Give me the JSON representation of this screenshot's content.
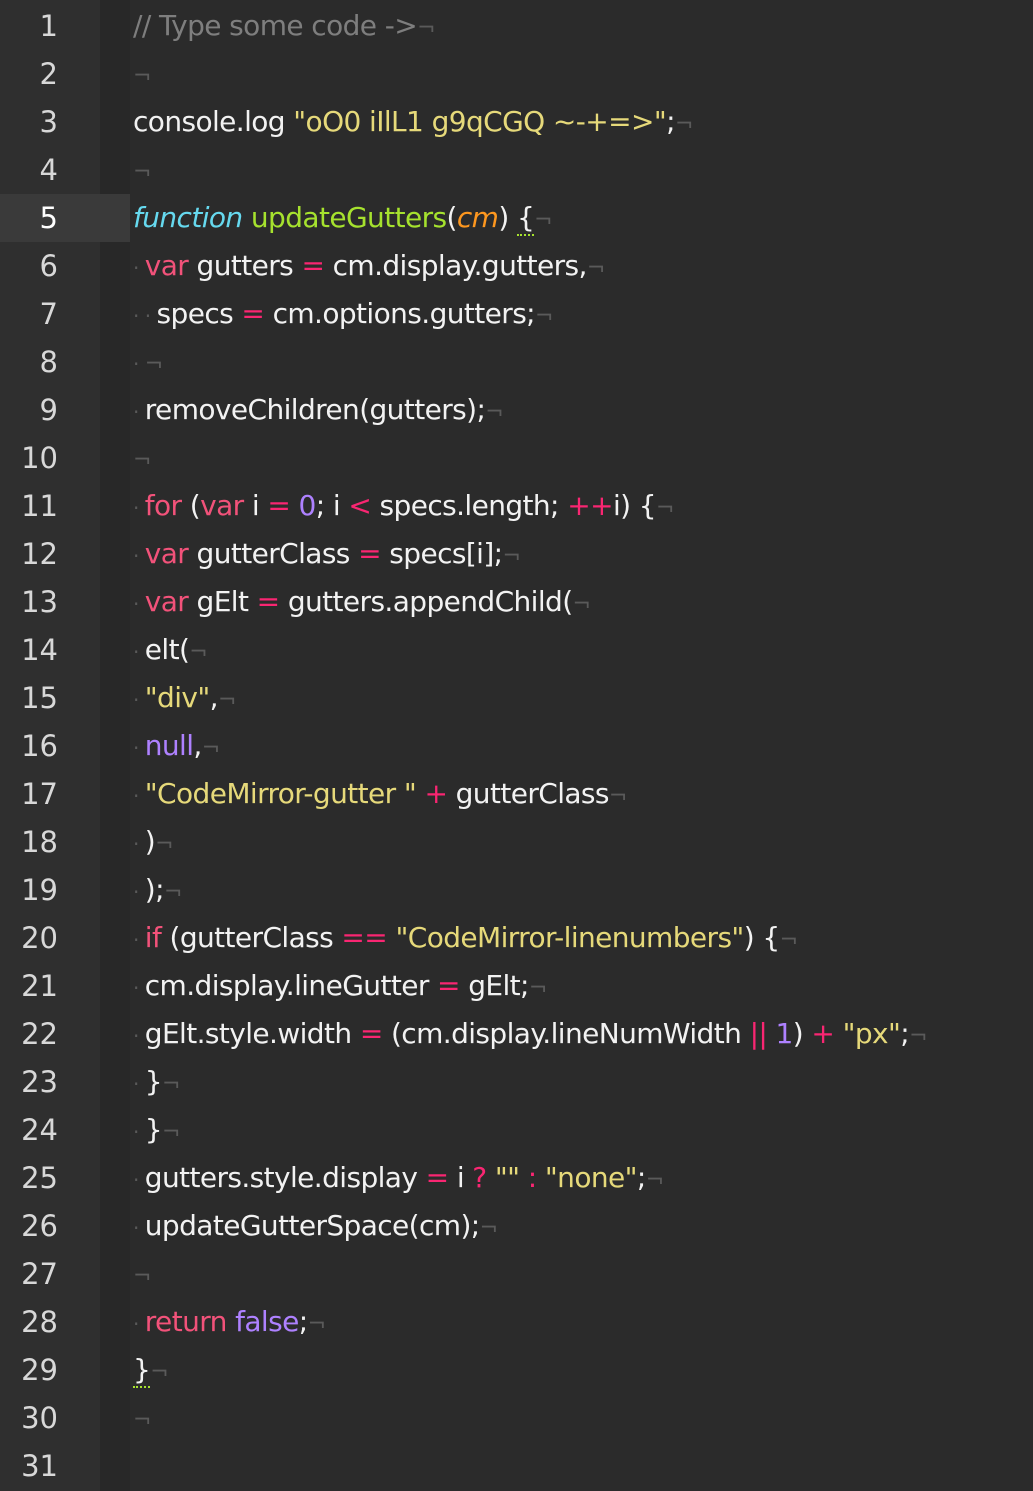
{
  "editor": {
    "active_line": 5,
    "lines": [
      {
        "n": "1",
        "indent": 0,
        "tokens": [
          {
            "c": "comment",
            "t": "// Type some code ->"
          }
        ]
      },
      {
        "n": "2",
        "indent": 0,
        "tokens": []
      },
      {
        "n": "3",
        "indent": 0,
        "tokens": [
          {
            "c": "plain",
            "t": "console.log "
          },
          {
            "c": "string",
            "t": "\"oO0 iIlL1 g9qCGQ ~-+=>\""
          },
          {
            "c": "punct",
            "t": ";"
          }
        ]
      },
      {
        "n": "4",
        "indent": 0,
        "tokens": []
      },
      {
        "n": "5",
        "indent": 0,
        "tokens": [
          {
            "c": "italic-kw",
            "t": "function"
          },
          {
            "c": "plain",
            "t": " "
          },
          {
            "c": "fn",
            "t": "updateGutters"
          },
          {
            "c": "punct",
            "t": "("
          },
          {
            "c": "param",
            "t": "cm"
          },
          {
            "c": "punct",
            "t": ") "
          },
          {
            "c": "brace",
            "t": "{"
          }
        ]
      },
      {
        "n": "6",
        "indent": 1,
        "tokens": [
          {
            "c": "keyword",
            "t": "var"
          },
          {
            "c": "plain",
            "t": " gutters "
          },
          {
            "c": "op",
            "t": "="
          },
          {
            "c": "plain",
            "t": " cm.display.gutters,"
          }
        ]
      },
      {
        "n": "7",
        "indent": 2,
        "tokens": [
          {
            "c": "plain",
            "t": "specs "
          },
          {
            "c": "op",
            "t": "="
          },
          {
            "c": "plain",
            "t": " cm.options.gutters;"
          }
        ]
      },
      {
        "n": "8",
        "indent": 1,
        "tokens": []
      },
      {
        "n": "9",
        "indent": 1,
        "tokens": [
          {
            "c": "plain",
            "t": "removeChildren(gutters);"
          }
        ]
      },
      {
        "n": "10",
        "indent": 0,
        "tokens": []
      },
      {
        "n": "11",
        "indent": 1,
        "tokens": [
          {
            "c": "keyword",
            "t": "for"
          },
          {
            "c": "plain",
            "t": " ("
          },
          {
            "c": "keyword",
            "t": "var"
          },
          {
            "c": "plain",
            "t": " i "
          },
          {
            "c": "op",
            "t": "="
          },
          {
            "c": "plain",
            "t": " "
          },
          {
            "c": "number",
            "t": "0"
          },
          {
            "c": "plain",
            "t": "; i "
          },
          {
            "c": "op",
            "t": "<"
          },
          {
            "c": "plain",
            "t": " specs.length; "
          },
          {
            "c": "op",
            "t": "++"
          },
          {
            "c": "plain",
            "t": "i) {"
          }
        ]
      },
      {
        "n": "12",
        "indent": 1,
        "tokens": [
          {
            "c": "keyword",
            "t": "var"
          },
          {
            "c": "plain",
            "t": " gutterClass "
          },
          {
            "c": "op",
            "t": "="
          },
          {
            "c": "plain",
            "t": " specs[i];"
          }
        ]
      },
      {
        "n": "13",
        "indent": 1,
        "tokens": [
          {
            "c": "keyword",
            "t": "var"
          },
          {
            "c": "plain",
            "t": " gElt "
          },
          {
            "c": "op",
            "t": "="
          },
          {
            "c": "plain",
            "t": " gutters.appendChild("
          }
        ]
      },
      {
        "n": "14",
        "indent": 1,
        "tokens": [
          {
            "c": "plain",
            "t": "elt("
          }
        ]
      },
      {
        "n": "15",
        "indent": 1,
        "tokens": [
          {
            "c": "string",
            "t": "\"div\""
          },
          {
            "c": "plain",
            "t": ","
          }
        ]
      },
      {
        "n": "16",
        "indent": 1,
        "tokens": [
          {
            "c": "constant",
            "t": "null"
          },
          {
            "c": "plain",
            "t": ","
          }
        ]
      },
      {
        "n": "17",
        "indent": 1,
        "tokens": [
          {
            "c": "string",
            "t": "\"CodeMirror-gutter \""
          },
          {
            "c": "plain",
            "t": " "
          },
          {
            "c": "op",
            "t": "+"
          },
          {
            "c": "plain",
            "t": " gutterClass"
          }
        ]
      },
      {
        "n": "18",
        "indent": 1,
        "tokens": [
          {
            "c": "plain",
            "t": ")"
          }
        ]
      },
      {
        "n": "19",
        "indent": 1,
        "tokens": [
          {
            "c": "plain",
            "t": ");"
          }
        ]
      },
      {
        "n": "20",
        "indent": 1,
        "tokens": [
          {
            "c": "keyword",
            "t": "if"
          },
          {
            "c": "plain",
            "t": " (gutterClass "
          },
          {
            "c": "op",
            "t": "=="
          },
          {
            "c": "plain",
            "t": " "
          },
          {
            "c": "string",
            "t": "\"CodeMirror-linenumbers\""
          },
          {
            "c": "plain",
            "t": ") {"
          }
        ]
      },
      {
        "n": "21",
        "indent": 1,
        "tokens": [
          {
            "c": "plain",
            "t": "cm.display.lineGutter "
          },
          {
            "c": "op",
            "t": "="
          },
          {
            "c": "plain",
            "t": " gElt;"
          }
        ]
      },
      {
        "n": "22",
        "indent": 1,
        "tokens": [
          {
            "c": "plain",
            "t": "gElt.style.width "
          },
          {
            "c": "op",
            "t": "="
          },
          {
            "c": "plain",
            "t": " (cm.display.lineNumWidth "
          },
          {
            "c": "op",
            "t": "||"
          },
          {
            "c": "plain",
            "t": " "
          },
          {
            "c": "number",
            "t": "1"
          },
          {
            "c": "plain",
            "t": ") "
          },
          {
            "c": "op",
            "t": "+"
          },
          {
            "c": "plain",
            "t": " "
          },
          {
            "c": "string",
            "t": "\"px\""
          },
          {
            "c": "plain",
            "t": ";"
          }
        ]
      },
      {
        "n": "23",
        "indent": 1,
        "tokens": [
          {
            "c": "plain",
            "t": "}"
          }
        ]
      },
      {
        "n": "24",
        "indent": 1,
        "tokens": [
          {
            "c": "plain",
            "t": "}"
          }
        ]
      },
      {
        "n": "25",
        "indent": 1,
        "tokens": [
          {
            "c": "plain",
            "t": "gutters.style.display "
          },
          {
            "c": "op",
            "t": "="
          },
          {
            "c": "plain",
            "t": " i "
          },
          {
            "c": "op",
            "t": "?"
          },
          {
            "c": "plain",
            "t": " "
          },
          {
            "c": "string",
            "t": "\"\""
          },
          {
            "c": "plain",
            "t": " "
          },
          {
            "c": "op",
            "t": ":"
          },
          {
            "c": "plain",
            "t": " "
          },
          {
            "c": "string",
            "t": "\"none\""
          },
          {
            "c": "plain",
            "t": ";"
          }
        ]
      },
      {
        "n": "26",
        "indent": 1,
        "tokens": [
          {
            "c": "plain",
            "t": "updateGutterSpace(cm);"
          }
        ]
      },
      {
        "n": "27",
        "indent": 0,
        "tokens": []
      },
      {
        "n": "28",
        "indent": 1,
        "tokens": [
          {
            "c": "keyword",
            "t": "return"
          },
          {
            "c": "plain",
            "t": " "
          },
          {
            "c": "constant",
            "t": "false"
          },
          {
            "c": "plain",
            "t": ";"
          }
        ]
      },
      {
        "n": "29",
        "indent": 0,
        "tokens": [
          {
            "c": "brace",
            "t": "}"
          }
        ]
      },
      {
        "n": "30",
        "indent": 0,
        "tokens": []
      },
      {
        "n": "31",
        "indent": -1,
        "tokens": []
      }
    ],
    "eol_marker": "¬",
    "indent_marker": "·"
  },
  "colors": {
    "background": "#2b2b2b",
    "gutter": "#2f2f2f",
    "active_line": "#3a3a3a",
    "comment": "#7e7e7e",
    "string": "#e6d97a",
    "keyword": "#f2527a",
    "function": "#a6e22e",
    "parameter": "#fd971f",
    "number": "#ae81ff"
  }
}
